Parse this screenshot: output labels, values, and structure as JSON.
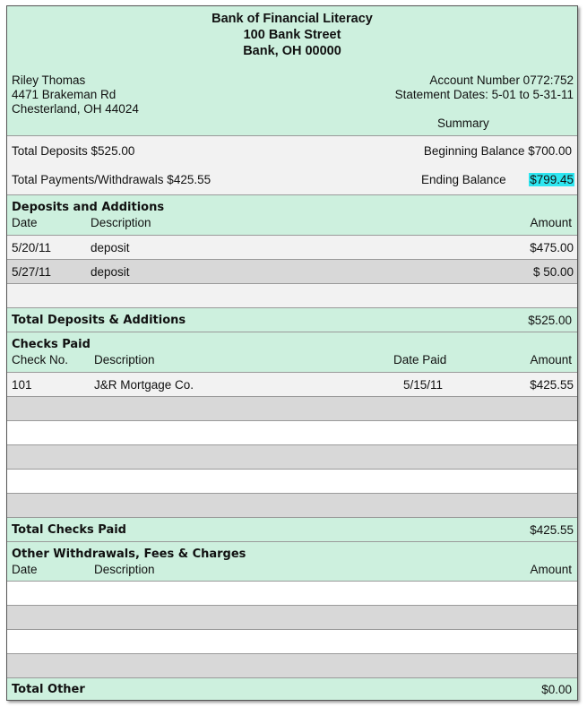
{
  "bank": {
    "name": "Bank of Financial Literacy",
    "street": "100 Bank Street",
    "city": "Bank, OH 00000"
  },
  "customer": {
    "name": "Riley Thomas",
    "address1": "4471 Brakeman Rd",
    "address2": "Chesterland, OH 44024"
  },
  "account": {
    "number": "Account Number 0772:752",
    "dates": "Statement Dates: 5-01 to 5-31-11"
  },
  "summary": {
    "heading": "Summary",
    "total_deposits": "Total Deposits  $525.00",
    "beginning_balance": "Beginning Balance  $700.00",
    "total_payments": "Total Payments/Withdrawals  $425.55",
    "ending_label": "Ending Balance",
    "ending_value": "$799.45"
  },
  "deposits": {
    "title": "Deposits and Additions",
    "col_date": "Date",
    "col_desc": "Description",
    "col_amount": "Amount",
    "rows": [
      {
        "date": "5/20/11",
        "desc": "deposit",
        "amount": "$475.00"
      },
      {
        "date": "5/27/11",
        "desc": "deposit",
        "amount": "$ 50.00"
      }
    ],
    "total_label": "Total Deposits & Additions",
    "total_value": "$525.00"
  },
  "checks": {
    "title": "Checks Paid",
    "col_no": "Check No.",
    "col_desc": "Description",
    "col_date": "Date Paid",
    "col_amount": "Amount",
    "rows": [
      {
        "no": "101",
        "desc": "J&R Mortgage Co.",
        "date": "5/15/11",
        "amount": "$425.55"
      }
    ],
    "total_label": "Total Checks Paid",
    "total_value": "$425.55"
  },
  "other": {
    "title": "Other Withdrawals, Fees & Charges",
    "col_date": "Date",
    "col_desc": "Description",
    "col_amount": "Amount",
    "total_label": "Total Other",
    "total_value": "$0.00"
  }
}
